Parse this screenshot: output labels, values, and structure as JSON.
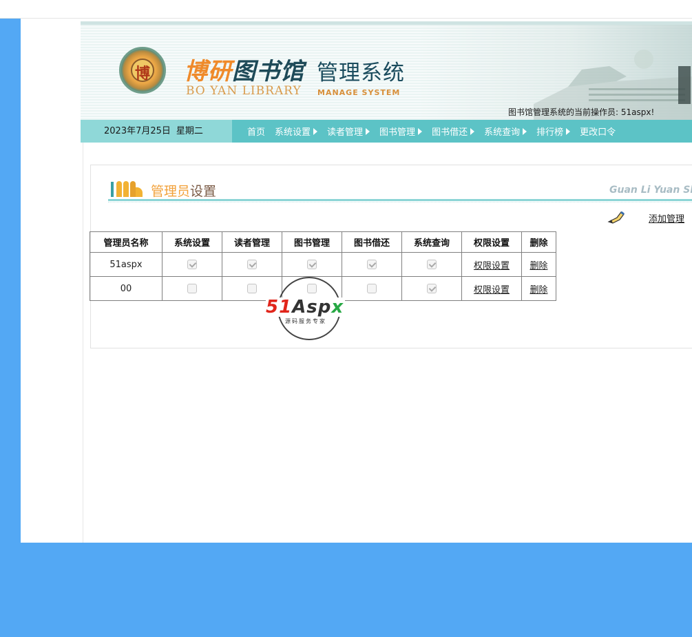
{
  "header": {
    "brand_cn_accent": "博研",
    "brand_cn_rest": "图书馆",
    "brand_system": "管理系统",
    "brand_en": "BO YAN LIBRARY",
    "brand_en_system": "MANAGE SYSTEM",
    "seal_glyph": "博",
    "operator_text": "图书馆管理系统的当前操作员: 51aspx!"
  },
  "nav": {
    "date": "2023年7月25日",
    "weekday": "星期二",
    "items": [
      {
        "label": "首页",
        "has_arrow": false
      },
      {
        "label": "系统设置",
        "has_arrow": true
      },
      {
        "label": "读者管理",
        "has_arrow": true
      },
      {
        "label": "图书管理",
        "has_arrow": true
      },
      {
        "label": "图书借还",
        "has_arrow": true
      },
      {
        "label": "系统查询",
        "has_arrow": true
      },
      {
        "label": "排行榜",
        "has_arrow": true
      },
      {
        "label": "更改口令",
        "has_arrow": false
      }
    ]
  },
  "section": {
    "title_accent": "管理员",
    "title_rest": "设置",
    "pinyin": "Guan Li Yuan Sh",
    "add_link": "添加管理"
  },
  "table": {
    "headers": [
      "管理员名称",
      "系统设置",
      "读者管理",
      "图书管理",
      "图书借还",
      "系统查询",
      "权限设置",
      "删除"
    ],
    "rows": [
      {
        "name": "51aspx",
        "sys": true,
        "reader": true,
        "book": true,
        "borrow": true,
        "query": true,
        "perm": "权限设置",
        "del": "删除"
      },
      {
        "name": "00",
        "sys": false,
        "reader": false,
        "book": false,
        "borrow": false,
        "query": true,
        "perm": "权限设置",
        "del": "删除"
      }
    ]
  },
  "watermark": {
    "num": "51",
    "asp": "Asp",
    "x": "x",
    "sub": "源码服务专家"
  },
  "colors": {
    "page_bg": "#53a8f4",
    "nav_bg": "#5cc3c6",
    "date_bg": "#8fd8d8",
    "accent_orange": "#f2a13a"
  }
}
